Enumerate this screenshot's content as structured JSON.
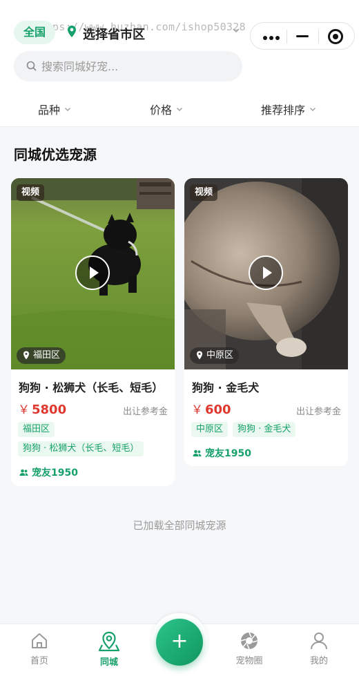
{
  "colors": {
    "primary": "#16a06a",
    "price": "#e0382e",
    "background": "#f6f7f9"
  },
  "header": {
    "watermark": "https://www.huzhan.com/ishop50328",
    "region_all": "全国",
    "region_select": "选择省市区",
    "search_placeholder": "搜索同城好宠..."
  },
  "filters": [
    {
      "label": "品种"
    },
    {
      "label": "价格"
    },
    {
      "label": "推荐排序"
    }
  ],
  "section_title": "同城优选宠源",
  "listings": [
    {
      "media_badge": "视频",
      "area": "福田区",
      "title": "狗狗 · 松狮犬（长毛、短毛）",
      "currency": "￥",
      "price": "5800",
      "price_note": "出让参考金",
      "tags": [
        "福田区",
        "狗狗 · 松狮犬（长毛、短毛）"
      ],
      "user": "宠友1950"
    },
    {
      "media_badge": "视频",
      "area": "中原区",
      "title": "狗狗 · 金毛犬",
      "currency": "￥",
      "price": "600",
      "price_note": "出让参考金",
      "tags": [
        "中原区",
        "狗狗 · 金毛犬"
      ],
      "user": "宠友1950"
    }
  ],
  "loaded_text": "已加载全部同城宠源",
  "tabbar": {
    "items": [
      {
        "label": "首页",
        "icon": "home-icon"
      },
      {
        "label": "同城",
        "icon": "map-pin-icon",
        "active": true
      },
      {
        "label": "宠物圈",
        "icon": "aperture-icon"
      },
      {
        "label": "我的",
        "icon": "user-icon"
      }
    ],
    "fab_symbol": "+"
  }
}
